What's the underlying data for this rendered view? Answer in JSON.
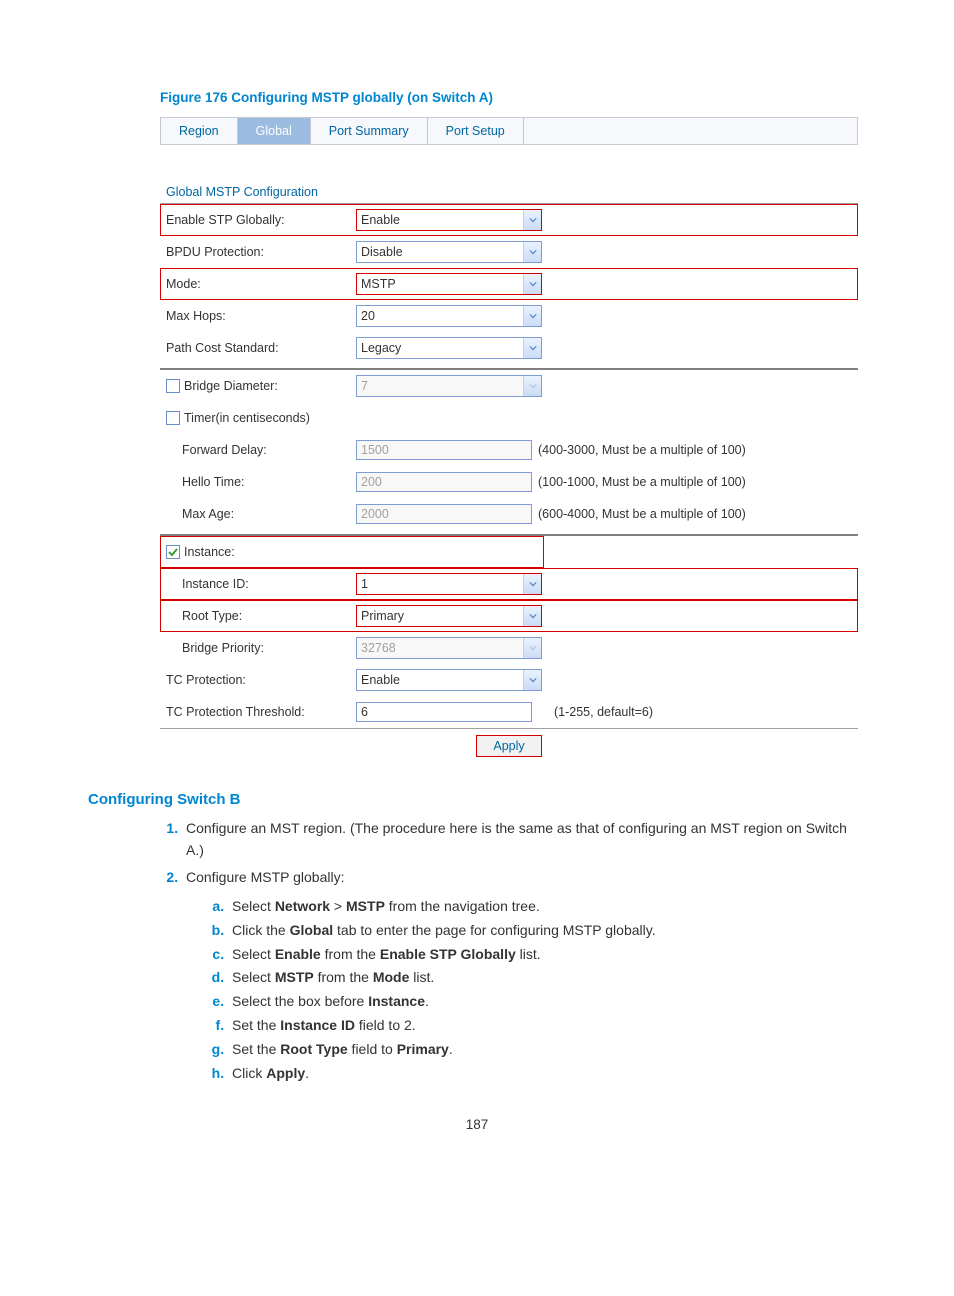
{
  "figure_caption": "Figure 176 Configuring MSTP globally (on Switch A)",
  "tabs": {
    "region": "Region",
    "global": "Global",
    "port_summary": "Port Summary",
    "port_setup": "Port Setup"
  },
  "panel_title": "Global MSTP Configuration",
  "labels": {
    "enable_stp": "Enable STP Globally:",
    "bpdu": "BPDU Protection:",
    "mode": "Mode:",
    "max_hops": "Max Hops:",
    "path_cost": "Path Cost Standard:",
    "bridge_diameter": "Bridge Diameter:",
    "timer": "Timer(in centiseconds)",
    "forward_delay": "Forward Delay:",
    "hello_time": "Hello Time:",
    "max_age": "Max Age:",
    "instance": "Instance:",
    "instance_id": "Instance ID:",
    "root_type": "Root Type:",
    "bridge_priority": "Bridge Priority:",
    "tc_protection": "TC Protection:",
    "tc_threshold": "TC Protection Threshold:"
  },
  "values": {
    "enable_stp": "Enable",
    "bpdu": "Disable",
    "mode": "MSTP",
    "max_hops": "20",
    "path_cost": "Legacy",
    "bridge_diameter": "7",
    "forward_delay": "1500",
    "hello_time": "200",
    "max_age": "2000",
    "instance_id": "1",
    "root_type": "Primary",
    "bridge_priority": "32768",
    "tc_protection": "Enable",
    "tc_threshold": "6"
  },
  "hints": {
    "forward_delay": "(400-3000, Must be a multiple of 100)",
    "hello_time": "(100-1000, Must be a multiple of 100)",
    "max_age": "(600-4000, Must be a multiple of 100)",
    "tc_threshold": "(1-255, default=6)"
  },
  "apply_label": "Apply",
  "section_heading": "Configuring Switch B",
  "steps": {
    "s1": "Configure an MST region. (The procedure here is the same as that of configuring an MST region on Switch A.)",
    "s2": "Configure MSTP globally:",
    "a_pre": "Select ",
    "a_b1": "Network",
    "a_mid": " > ",
    "a_b2": "MSTP",
    "a_post": " from the navigation tree.",
    "b_pre": "Click the ",
    "b_b1": "Global",
    "b_post": " tab to enter the page for configuring MSTP globally.",
    "c_pre": "Select ",
    "c_b1": "Enable",
    "c_mid": " from the ",
    "c_b2": "Enable STP Globally",
    "c_post": " list.",
    "d_pre": "Select ",
    "d_b1": "MSTP",
    "d_mid": " from the ",
    "d_b2": "Mode",
    "d_post": " list.",
    "e_pre": "Select the box before ",
    "e_b1": "Instance",
    "e_post": ".",
    "f_pre": "Set the ",
    "f_b1": "Instance ID",
    "f_post": " field to 2.",
    "g_pre": "Set the ",
    "g_b1": "Root Type",
    "g_mid": " field to ",
    "g_b2": "Primary",
    "g_post": ".",
    "h_pre": "Click ",
    "h_b1": "Apply",
    "h_post": "."
  },
  "page_number": "187"
}
